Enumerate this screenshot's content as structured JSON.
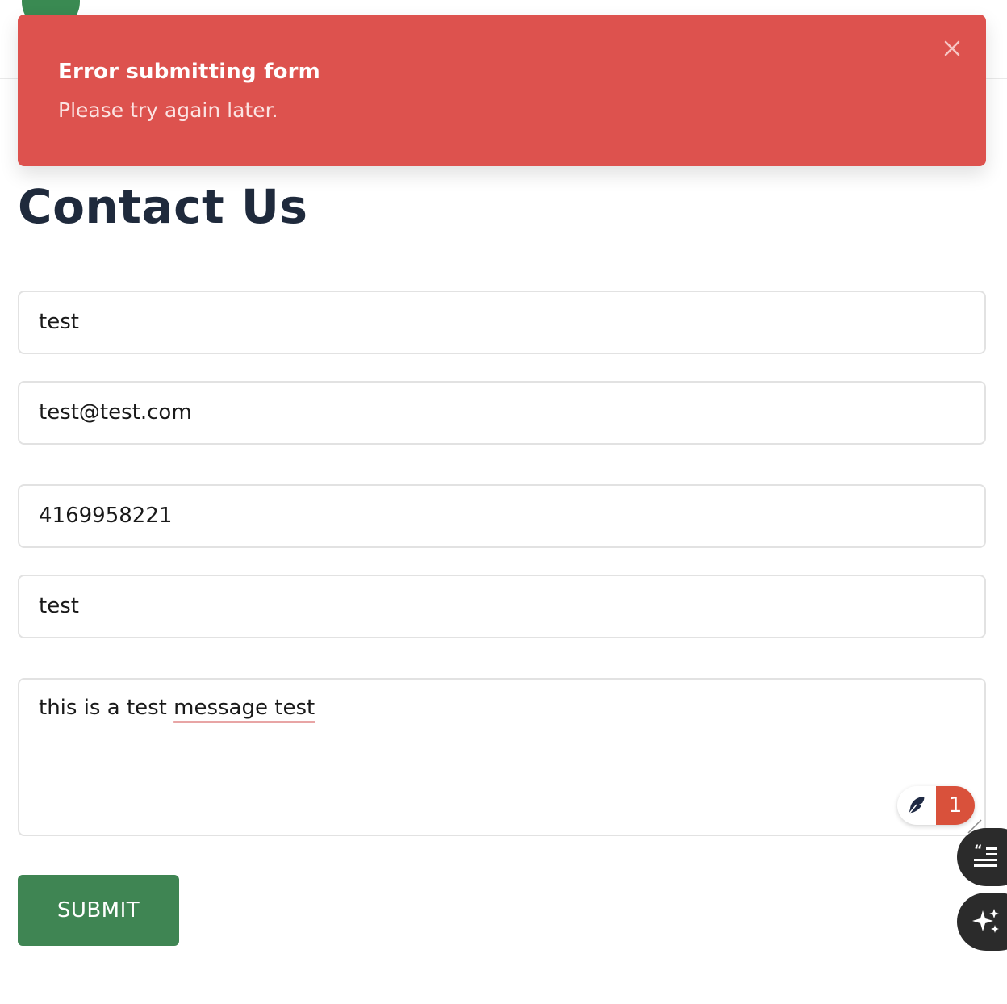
{
  "toast": {
    "title": "Error submitting form",
    "message": "Please try again later.",
    "background": "#dd524e"
  },
  "form": {
    "title": "Contact Us",
    "fields": {
      "name": "test",
      "email": "test@test.com",
      "phone": "4169958221",
      "subject": "test",
      "message_plain": "this is a test ",
      "message_flagged": "message test"
    },
    "submit_label": "SUBMIT",
    "submit_color": "#3f8553"
  },
  "grammar_badge": {
    "count": "1",
    "icon": "feather-icon"
  },
  "side_buttons": [
    {
      "icon": "quote-list-icon"
    },
    {
      "icon": "sparkles-icon"
    }
  ]
}
